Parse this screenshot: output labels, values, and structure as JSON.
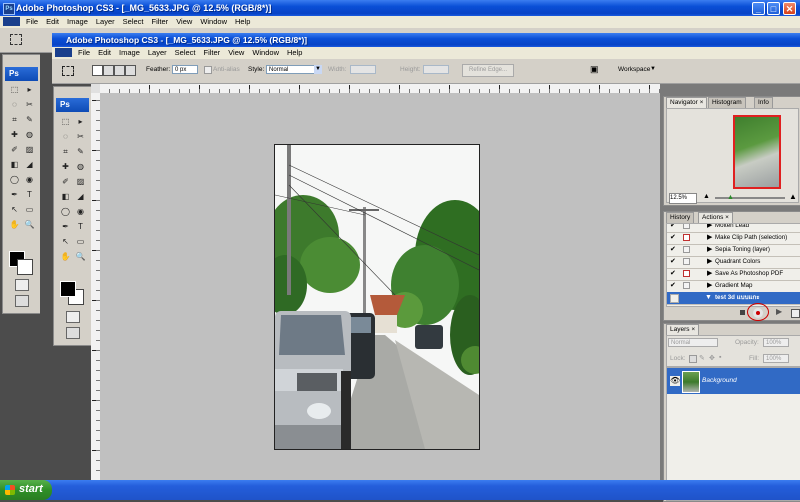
{
  "outer_window": {
    "title": "Adobe Photoshop CS3 - [_MG_5633.JPG @ 12.5% (RGB/8*)]",
    "menu": [
      "File",
      "Edit",
      "Image",
      "Layer",
      "Select",
      "Filter",
      "View",
      "Window",
      "Help"
    ]
  },
  "inner_window": {
    "title": "Adobe Photoshop CS3 - [_MG_5633.JPG @ 12.5% (RGB/8*)]",
    "menu": [
      "File",
      "Edit",
      "Image",
      "Layer",
      "Select",
      "Filter",
      "View",
      "Window",
      "Help"
    ]
  },
  "options_bar": {
    "feather_label": "Feather:",
    "feather_value": "0 px",
    "antialias_label": "Anti-alias",
    "style_label": "Style:",
    "style_value": "Normal",
    "width_label": "Width:",
    "height_label": "Height:",
    "refine_label": "Refine Edge...",
    "workspace_label": "Workspace"
  },
  "toolbox": {
    "logo": "Ps"
  },
  "navigator": {
    "tabs": [
      "Navigator",
      "Histogram",
      "Info"
    ],
    "zoom": "12.5%"
  },
  "actions_panel": {
    "tabs": [
      "History",
      "Actions"
    ],
    "items": [
      {
        "label": "Molten Lead",
        "checked": true,
        "dialog": false
      },
      {
        "label": "Make Clip Path (selection)",
        "checked": true,
        "dialog": true
      },
      {
        "label": "Sepia Toning (layer)",
        "checked": true,
        "dialog": false
      },
      {
        "label": "Quadrant Colors",
        "checked": true,
        "dialog": false
      },
      {
        "label": "Save As Photoshop PDF",
        "checked": true,
        "dialog": true
      },
      {
        "label": "Gradient Map",
        "checked": true,
        "dialog": false
      }
    ],
    "set_label": "test 3d แบบแกะ",
    "colors": {
      "highlight": "#316ac5",
      "record_ring": "#cc0000"
    }
  },
  "layers_panel": {
    "tab": "Layers",
    "blend_mode": "Normal",
    "opacity_label": "Opacity:",
    "opacity_value": "100%",
    "lock_label": "Lock:",
    "fill_label": "Fill:",
    "fill_value": "100%",
    "layer_name": "Background"
  },
  "taskbar": {
    "start_label": "start"
  }
}
